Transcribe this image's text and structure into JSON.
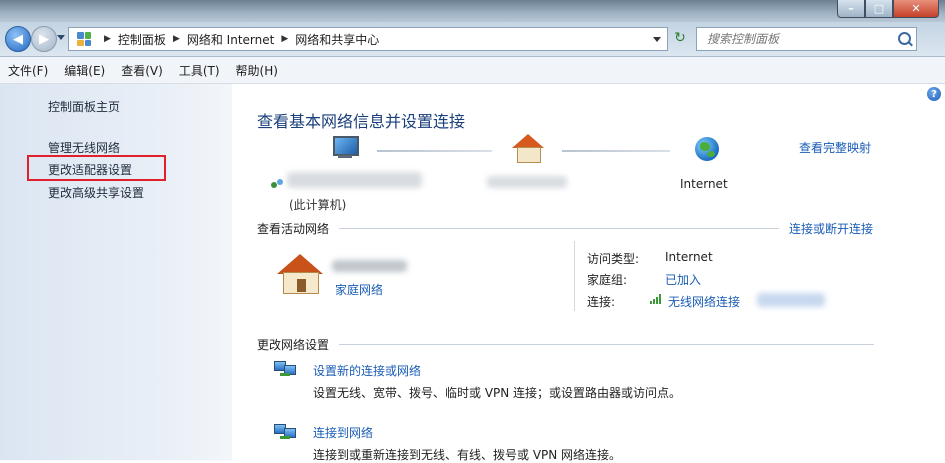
{
  "address": {
    "crumbs": [
      "控制面板",
      "网络和 Internet",
      "网络和共享中心"
    ],
    "search_placeholder": "搜索控制面板"
  },
  "menu": [
    "文件(F)",
    "编辑(E)",
    "查看(V)",
    "工具(T)",
    "帮助(H)"
  ],
  "sidebar": {
    "home": "控制面板主页",
    "items": [
      "管理无线网络",
      "更改适配器设置",
      "更改高级共享设置"
    ]
  },
  "main": {
    "title": "查看基本网络信息并设置连接",
    "full_map": "查看完整映射",
    "pc_label": "(此计算机)",
    "internet_label": "Internet",
    "active_title": "查看活动网络",
    "connect_link": "连接或断开连接",
    "home_network": "家庭网络",
    "info": {
      "access_label": "访问类型:",
      "access_value": "Internet",
      "homegroup_label": "家庭组:",
      "homegroup_value": "已加入",
      "conn_label": "连接:",
      "conn_value": "无线网络连接"
    },
    "change_title": "更改网络设置",
    "settings": [
      {
        "title": "设置新的连接或网络",
        "desc": "设置无线、宽带、拨号、临时或 VPN 连接；或设置路由器或访问点。"
      },
      {
        "title": "连接到网络",
        "desc": "连接到或重新连接到无线、有线、拨号或 VPN 网络连接。"
      }
    ]
  }
}
